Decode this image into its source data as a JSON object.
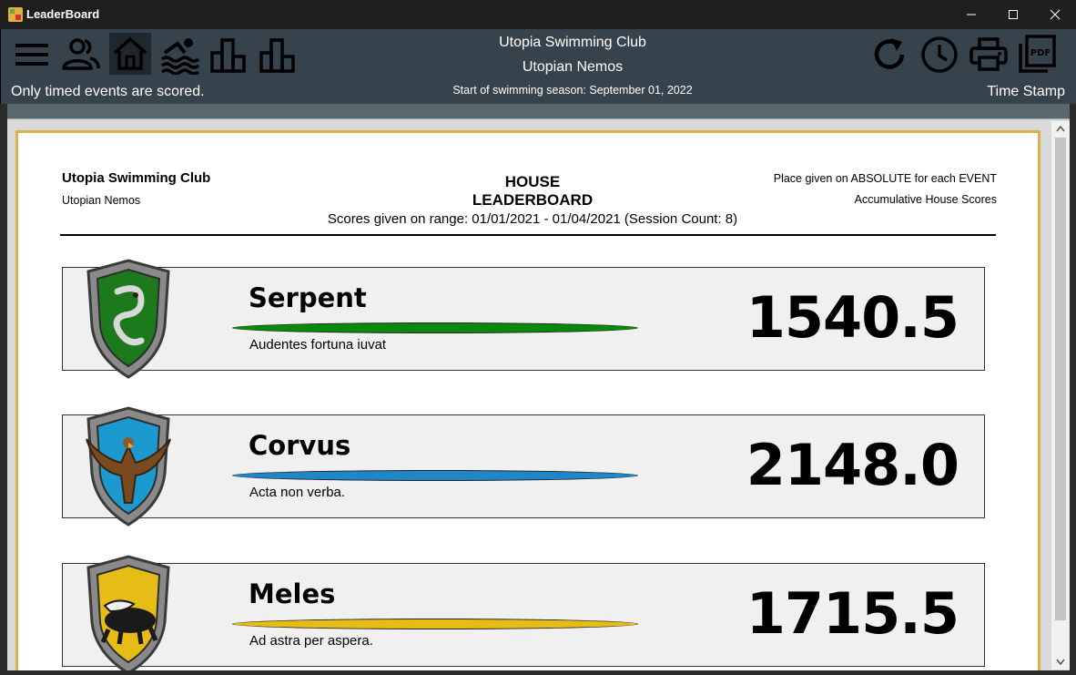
{
  "window": {
    "title": "LeaderBoard"
  },
  "toolbar": {
    "note": "Only timed events are scored.",
    "club_name": "Utopia Swimming Club",
    "team_name": "Utopian Nemos",
    "season_start": "Start of swimming season: September 01, 2022",
    "timestamp_label": "Time Stamp",
    "left_icons": [
      "menu-icon",
      "members-icon",
      "home-icon",
      "swimmer-icon",
      "bar-chart-icon",
      "bar-chart-icon"
    ],
    "right_icons": [
      "refresh-icon",
      "clock-icon",
      "print-icon",
      "pdf-icon"
    ]
  },
  "report": {
    "club_name": "Utopia Swimming Club",
    "team_name": "Utopian Nemos",
    "title_line1": "HOUSE",
    "title_line2": "LEADERBOARD",
    "range": "Scores given on range: 01/01/2021 - 01/04/2021 (Session Count: 8)",
    "place_note": "Place given on ABSOLUTE for each EVENT",
    "scoring_note": "Accumulative House Scores",
    "houses": [
      {
        "name": "Serpent",
        "motto": "Audentes fortuna iuvat",
        "score": "1540.5",
        "color": "#0a8a0a",
        "crest": "serpent-crest"
      },
      {
        "name": "Corvus",
        "motto": "Acta non verba.",
        "score": "2148.0",
        "color": "#1f86c8",
        "crest": "eagle-crest"
      },
      {
        "name": "Meles",
        "motto": "Ad astra per aspera.",
        "score": "1715.5",
        "color": "#e6bd17",
        "crest": "badger-crest"
      }
    ]
  }
}
